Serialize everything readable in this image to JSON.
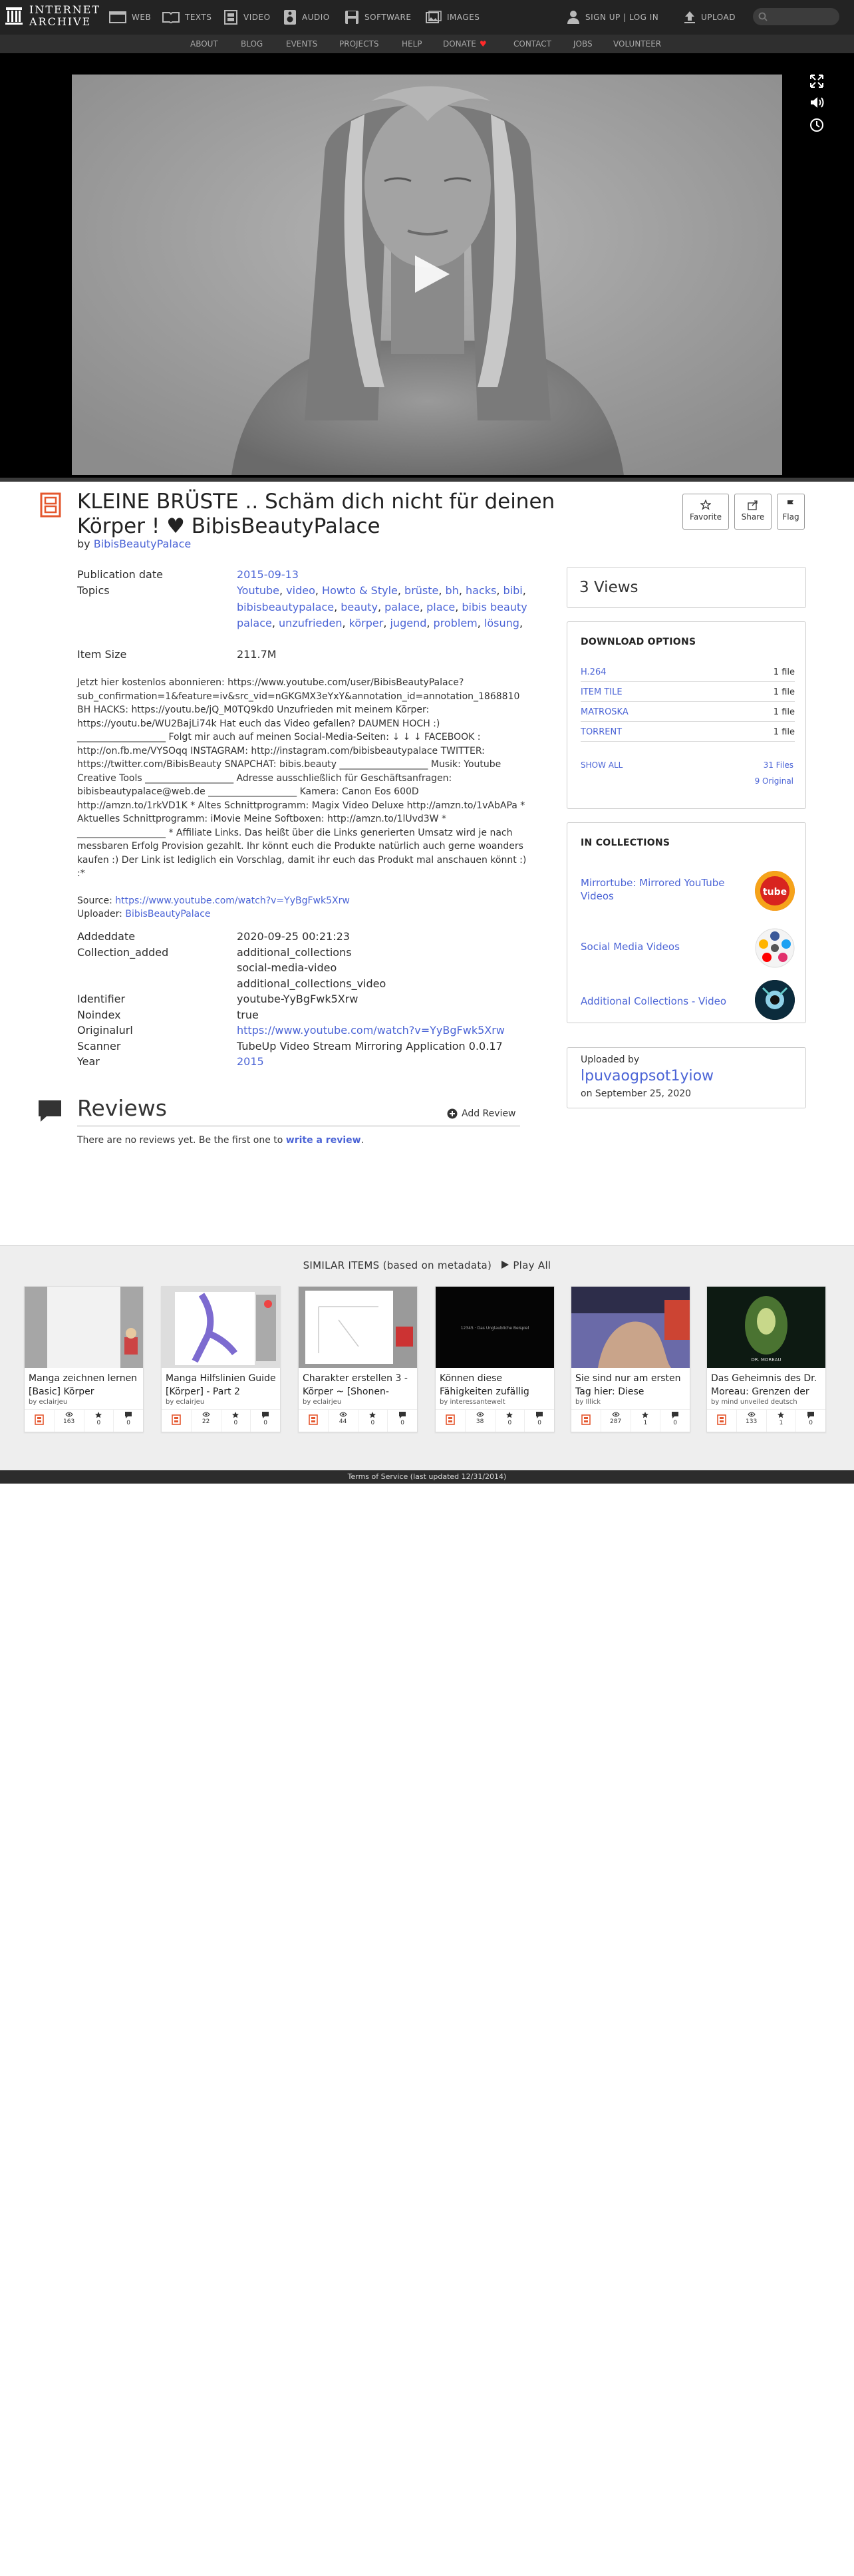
{
  "topbar": {
    "logo_line1": "INTERNET",
    "logo_line2": "ARCHIVE",
    "nav": [
      {
        "label": "WEB",
        "icon": "web-icon"
      },
      {
        "label": "TEXTS",
        "icon": "book-icon"
      },
      {
        "label": "VIDEO",
        "icon": "film-icon"
      },
      {
        "label": "AUDIO",
        "icon": "speaker-icon"
      },
      {
        "label": "SOFTWARE",
        "icon": "floppy-icon"
      },
      {
        "label": "IMAGES",
        "icon": "image-icon"
      }
    ],
    "signup": "SIGN UP | LOG IN",
    "upload": "UPLOAD"
  },
  "subnav": [
    "ABOUT",
    "BLOG",
    "EVENTS",
    "PROJECTS",
    "HELP",
    "DONATE",
    "CONTACT",
    "JOBS",
    "VOLUNTEER"
  ],
  "item": {
    "title": "KLEINE BRÜSTE .. Schäm dich nicht für deinen Körper ! ♥ BibisBeautyPalace",
    "by_label": "by ",
    "by": "BibisBeautyPalace",
    "actions": {
      "favorite": "Favorite",
      "share": "Share",
      "flag": "Flag"
    }
  },
  "metadata": {
    "pubdate_label": "Publication date",
    "pubdate": "2015-09-13",
    "topics_label": "Topics",
    "topics": [
      "Youtube",
      "video",
      "Howto & Style",
      "brüste",
      "bh",
      "hacks",
      "bibi",
      "bibisbeautypalace",
      "beauty",
      "palace",
      "place",
      "bibis beauty palace",
      "unzufrieden",
      "körper",
      "jugend",
      "problem",
      "lösung"
    ],
    "size_label": "Item Size",
    "size": "211.7M"
  },
  "description": "Jetzt hier kostenlos abonnieren: https://www.youtube.com/user/BibisBeautyPalace?sub_confirmation=1&feature=iv&src_vid=nGKGMX3eYxY&annotation_id=annotation_1868810 BH HACKS: https://youtu.be/jQ_M0TQ9kd0 Unzufrieden mit meinem Körper: https://youtu.be/WU2BajLi74k Hat euch das Video gefallen? DAUMEN HOCH :) ___________________ Folgt mir auch auf meinen Social-Media-Seiten: ↓ ↓ ↓ FACEBOOK : http://on.fb.me/VYSOqq INSTAGRAM: http://instagram.com/bibisbeautypalace TWITTER: https://twitter.com/BibisBeauty SNAPCHAT: bibis.beauty ___________________ Musik: Youtube Creative Tools ___________________ Adresse ausschließlich für Geschäftsanfragen: bibisbeautypalace@web.de ___________________ Kamera: Canon Eos 600D http://amzn.to/1rkVD1K * Altes Schnittprogramm: Magix Video Deluxe http://amzn.to/1vAbAPa * Aktuelles Schnittprogramm: iMovie Meine Softboxen: http://amzn.to/1lUvd3W * ___________________ * Affiliate Links. Das heißt über die Links generierten Umsatz wird je nach messbaren Erfolg Provision gezahlt. Ihr könnt euch die Produkte natürlich auch gerne woanders kaufen :) Der Link ist lediglich ein Vorschlag, damit ihr euch das Produkt mal anschauen könnt :) :*",
  "source": {
    "label": "Source: ",
    "url": "https://www.youtube.com/watch?v=YyBgFwk5Xrw"
  },
  "uploader_line": {
    "label": "Uploader: ",
    "name": "BibisBeautyPalace"
  },
  "fields": [
    {
      "label": "Addeddate",
      "value": "2020-09-25 00:21:23"
    },
    {
      "label": "Collection_added",
      "value": "additional_collections"
    },
    {
      "label": "",
      "value": "social-media-video"
    },
    {
      "label": "",
      "value": "additional_collections_video"
    },
    {
      "label": "Identifier",
      "value": "youtube-YyBgFwk5Xrw"
    },
    {
      "label": "Noindex",
      "value": "true"
    },
    {
      "label": "Originalurl",
      "value": "https://www.youtube.com/watch?v=YyBgFwk5Xrw"
    },
    {
      "label": "Scanner",
      "value": "TubeUp Video Stream Mirroring Application 0.0.17"
    },
    {
      "label": "Year",
      "value": "2015"
    }
  ],
  "reviews": {
    "title": "Reviews",
    "add": "Add Review",
    "none_text": "There are no reviews yet. Be the first one to ",
    "none_link": "write a review",
    "none_end": "."
  },
  "views": "3 Views",
  "download": {
    "heading": "DOWNLOAD OPTIONS",
    "rows": [
      {
        "name": "H.264",
        "count": "1 file"
      },
      {
        "name": "ITEM TILE",
        "count": "1 file"
      },
      {
        "name": "MATROSKA",
        "count": "1 file"
      },
      {
        "name": "TORRENT",
        "count": "1 file"
      }
    ],
    "show_all": "SHOW ALL",
    "files": "31 Files",
    "original": "9 Original"
  },
  "collections": {
    "heading": "IN COLLECTIONS",
    "items": [
      {
        "label": "Mirrortube: Mirrored YouTube Videos",
        "thumb_text": "tube"
      },
      {
        "label": "Social Media Videos"
      },
      {
        "label": "Additional Collections - Video"
      }
    ]
  },
  "uploaded_by": {
    "label": "Uploaded by",
    "name": "lpuvaogpsot1yiow",
    "date": "on September 25, 2020"
  },
  "similar": {
    "heading": "SIMILAR ITEMS (based on metadata)",
    "play_all": "Play All",
    "items": [
      {
        "title": "Manga zeichnen lernen [Basic] Körper",
        "by": "by eclairjeu",
        "views": "163",
        "favs": "0",
        "reviews": "0"
      },
      {
        "title": "Manga Hilfslinien Guide [Körper] - Part 2",
        "by": "by eclairjeu",
        "views": "22",
        "favs": "0",
        "reviews": "0"
      },
      {
        "title": "Charakter erstellen 3 - Körper ~ [Shonen-",
        "by": "by eclairjeu",
        "views": "44",
        "favs": "0",
        "reviews": "0"
      },
      {
        "title": "Können diese Fähigkeiten zufällig",
        "by": "by interessantewelt",
        "views": "38",
        "favs": "0",
        "reviews": "0",
        "thumb_caption": "12345 · Das Unglaubliche Beispiel"
      },
      {
        "title": "Sie sind nur am ersten Tag hier: Diese",
        "by": "by Illick",
        "views": "287",
        "favs": "1",
        "reviews": "0"
      },
      {
        "title": "Das Geheimnis des Dr. Moreau: Grenzen der",
        "by": "by mind unveiled deutsch",
        "views": "133",
        "favs": "1",
        "reviews": "0",
        "thumb_caption": "DR. MOREAU"
      }
    ]
  },
  "footer": "Terms of Service (last updated 12/31/2014)",
  "colors": {
    "link": "#4b64d6",
    "topbar": "#232323",
    "accent_video": "#e4572e",
    "donate_heart": "#ff2a2a"
  }
}
